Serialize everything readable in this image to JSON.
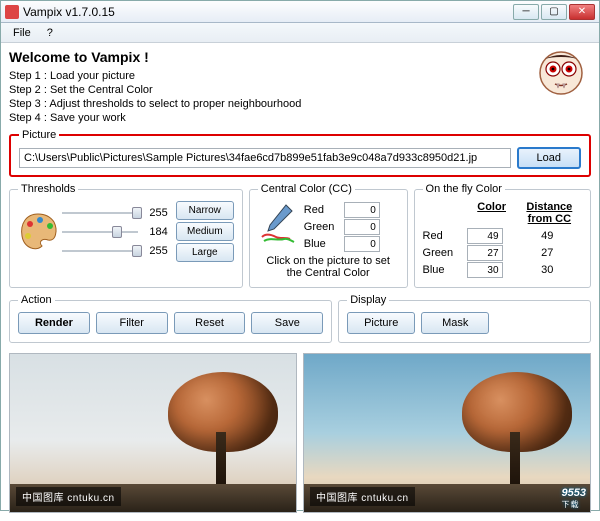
{
  "window": {
    "title": "Vampix v1.7.0.15"
  },
  "menu": {
    "file": "File",
    "help": "?"
  },
  "welcome": {
    "heading": "Welcome to Vampix !",
    "step1": "Step 1 : Load your picture",
    "step2": "Step 2 : Set the Central Color",
    "step3": "Step 3 : Adjust thresholds to select to proper neighbourhood",
    "step4": "Step 4 : Save your work"
  },
  "picture": {
    "legend": "Picture",
    "path": "C:\\Users\\Public\\Pictures\\Sample Pictures\\34fae6cd7b899e51fab3e9c048a7d933c8950d21.jp",
    "load": "Load"
  },
  "thresholds": {
    "legend": "Thresholds",
    "v1": "255",
    "v2": "184",
    "v3": "255",
    "narrow": "Narrow",
    "medium": "Medium",
    "large": "Large"
  },
  "centralColor": {
    "legend": "Central Color (CC)",
    "red_lbl": "Red",
    "red_val": "0",
    "green_lbl": "Green",
    "green_val": "0",
    "blue_lbl": "Blue",
    "blue_val": "0",
    "hint1": "Click on the picture to set",
    "hint2": "the Central Color"
  },
  "onTheFly": {
    "legend": "On the fly Color",
    "col_color": "Color",
    "col_dist": "Distance from CC",
    "red_lbl": "Red",
    "red_val": "49",
    "red_dist": "49",
    "green_lbl": "Green",
    "green_val": "27",
    "green_dist": "27",
    "blue_lbl": "Blue",
    "blue_val": "30",
    "blue_dist": "30"
  },
  "action": {
    "legend": "Action",
    "render": "Render",
    "filter": "Filter",
    "reset": "Reset",
    "save": "Save"
  },
  "display": {
    "legend": "Display",
    "picture": "Picture",
    "mask": "Mask"
  },
  "preview": {
    "watermark": "中国图库 cntuku.cn",
    "logo": "9553",
    "logo_sub": "下载"
  }
}
